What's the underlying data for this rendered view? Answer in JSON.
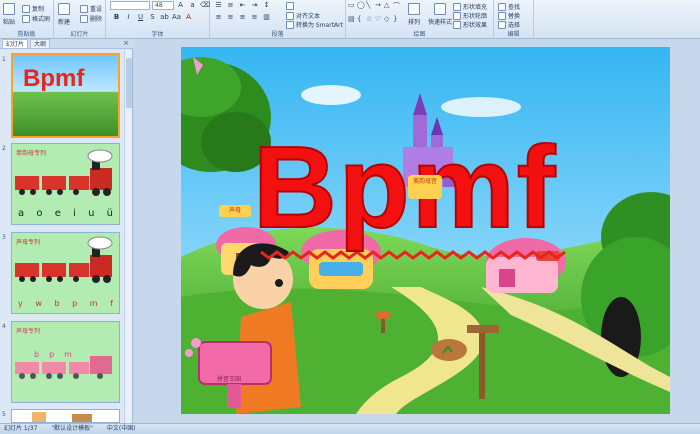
{
  "ribbon": {
    "clipboard": {
      "paste": "粘贴",
      "copy": "复制",
      "format_painter": "格式刷",
      "label": "剪贴板"
    },
    "slides": {
      "new_slide": "新建",
      "reset": "重设",
      "delete": "删除",
      "label": "幻灯片"
    },
    "font": {
      "size": "48",
      "label": "字体"
    },
    "paragraph": {
      "align_text": "对齐文本",
      "convert_smartart": "转换为 SmartArt",
      "label": "段落"
    },
    "drawing": {
      "arrange": "排列",
      "quick_styles": "快速样式",
      "shape_fill": "形状填充",
      "shape_outline": "形状轮廓",
      "shape_effects": "形状效果",
      "label": "绘图"
    },
    "editing": {
      "find": "查找",
      "replace": "替换",
      "select": "选择",
      "label": "编辑"
    }
  },
  "pane": {
    "tabs": [
      "幻灯片",
      "大纲"
    ],
    "thumbs": [
      {
        "num": "1",
        "title": "Bpmf"
      },
      {
        "num": "2",
        "title": "单韵母专列",
        "letters": [
          "a",
          "o",
          "e",
          "i",
          "u",
          "ü"
        ]
      },
      {
        "num": "3",
        "title": "声母专列",
        "letters": [
          "y",
          "w",
          "b",
          "p",
          "m",
          "f"
        ]
      },
      {
        "num": "4",
        "title": "声母专列",
        "letters": [
          "b",
          "p",
          "m"
        ]
      },
      {
        "num": "5"
      }
    ]
  },
  "slide": {
    "title": "Bpmf",
    "sign": "拼音王国",
    "castle_sign": "美韵母宫",
    "house_sign": "声母"
  },
  "status": {
    "slide_count": "幻灯片 1/37",
    "theme": "\"默认设计模板\"",
    "language": "中文(中国)"
  }
}
